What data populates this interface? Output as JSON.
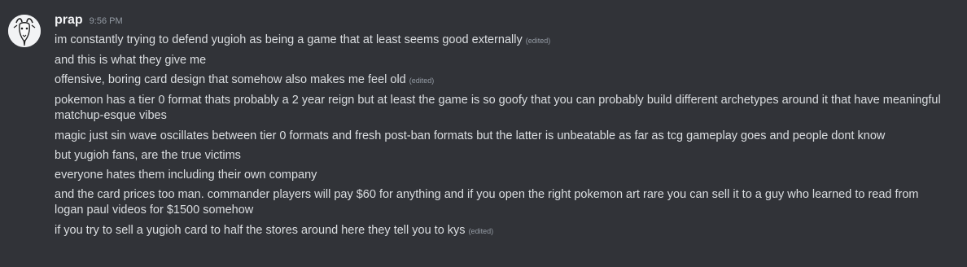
{
  "user": {
    "name": "prap",
    "timestamp": "9:56 PM",
    "avatar_icon": "goat-sketch-avatar"
  },
  "edited_label": "(edited)",
  "messages": [
    {
      "text": "im constantly trying to defend yugioh as being a game that at least seems good externally",
      "edited": true
    },
    {
      "text": "and this is what they give me",
      "edited": false
    },
    {
      "text": "offensive, boring card design that somehow also makes me feel old",
      "edited": true
    },
    {
      "text": "pokemon has a tier 0 format thats probably a 2 year reign but at least the game is so goofy that you can probably build different archetypes around it that have meaningful matchup-esque vibes",
      "edited": false
    },
    {
      "text": "magic just sin wave oscillates between tier 0 formats and fresh post-ban formats but the latter is unbeatable as far as tcg gameplay goes and people dont know",
      "edited": false
    },
    {
      "text": "but yugioh fans, are the true victims",
      "edited": false
    },
    {
      "text": "everyone hates them including their own company",
      "edited": false
    },
    {
      "text": "and the card prices too man. commander players will pay $60 for anything and if you open the right pokemon art rare you can sell it to a guy who learned to read from logan paul videos for $1500 somehow",
      "edited": false
    },
    {
      "text": "if you try to sell a yugioh card to half the stores around here they tell you to kys",
      "edited": true
    }
  ],
  "colors": {
    "background": "#313338",
    "text": "#dbdee1",
    "username": "#f2f3f5",
    "muted": "#949ba4"
  }
}
